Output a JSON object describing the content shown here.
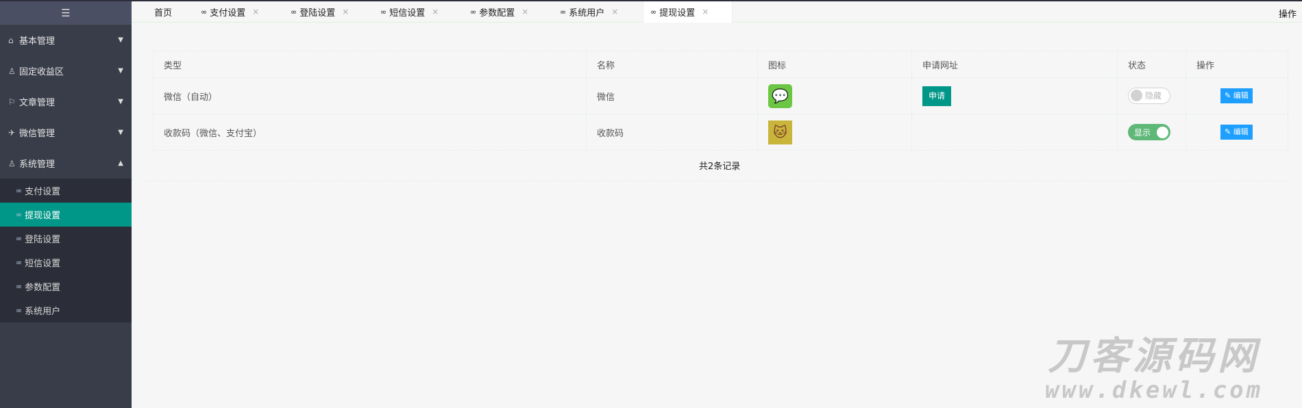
{
  "sidebar": {
    "toggle_icon": "☰",
    "menus": [
      {
        "label": "基本管理",
        "icon": "⌂"
      },
      {
        "label": "固定收益区",
        "icon": "♙"
      },
      {
        "label": "文章管理",
        "icon": "⚐"
      },
      {
        "label": "微信管理",
        "icon": "✈"
      },
      {
        "label": "系统管理",
        "icon": "♙"
      }
    ],
    "submenu": [
      "支付设置",
      "提现设置",
      "登陆设置",
      "短信设置",
      "参数配置",
      "系统用户"
    ]
  },
  "tabs": {
    "home": "首页",
    "items": [
      "支付设置",
      "登陆设置",
      "短信设置",
      "参数配置",
      "系统用户",
      "提现设置"
    ],
    "close": "×",
    "ops": "操作"
  },
  "table": {
    "headers": [
      "类型",
      "名称",
      "图标",
      "申请网址",
      "状态",
      "操作"
    ],
    "rows": [
      {
        "type": "微信（自动）",
        "name": "微信",
        "apply": "申请",
        "status": "隐藏",
        "edit": "编辑"
      },
      {
        "type": "收款码（微信、支付宝）",
        "name": "收款码",
        "apply": "",
        "status": "显示",
        "edit": "编辑"
      }
    ]
  },
  "total": "共2条记录",
  "watermark": {
    "title": "刀客源码网",
    "url": "www.dkewl.com"
  },
  "colors": {
    "accent": "#009688",
    "edit": "#1e9fff",
    "switch_on": "#5fb878",
    "sidebar": "#393d49"
  }
}
